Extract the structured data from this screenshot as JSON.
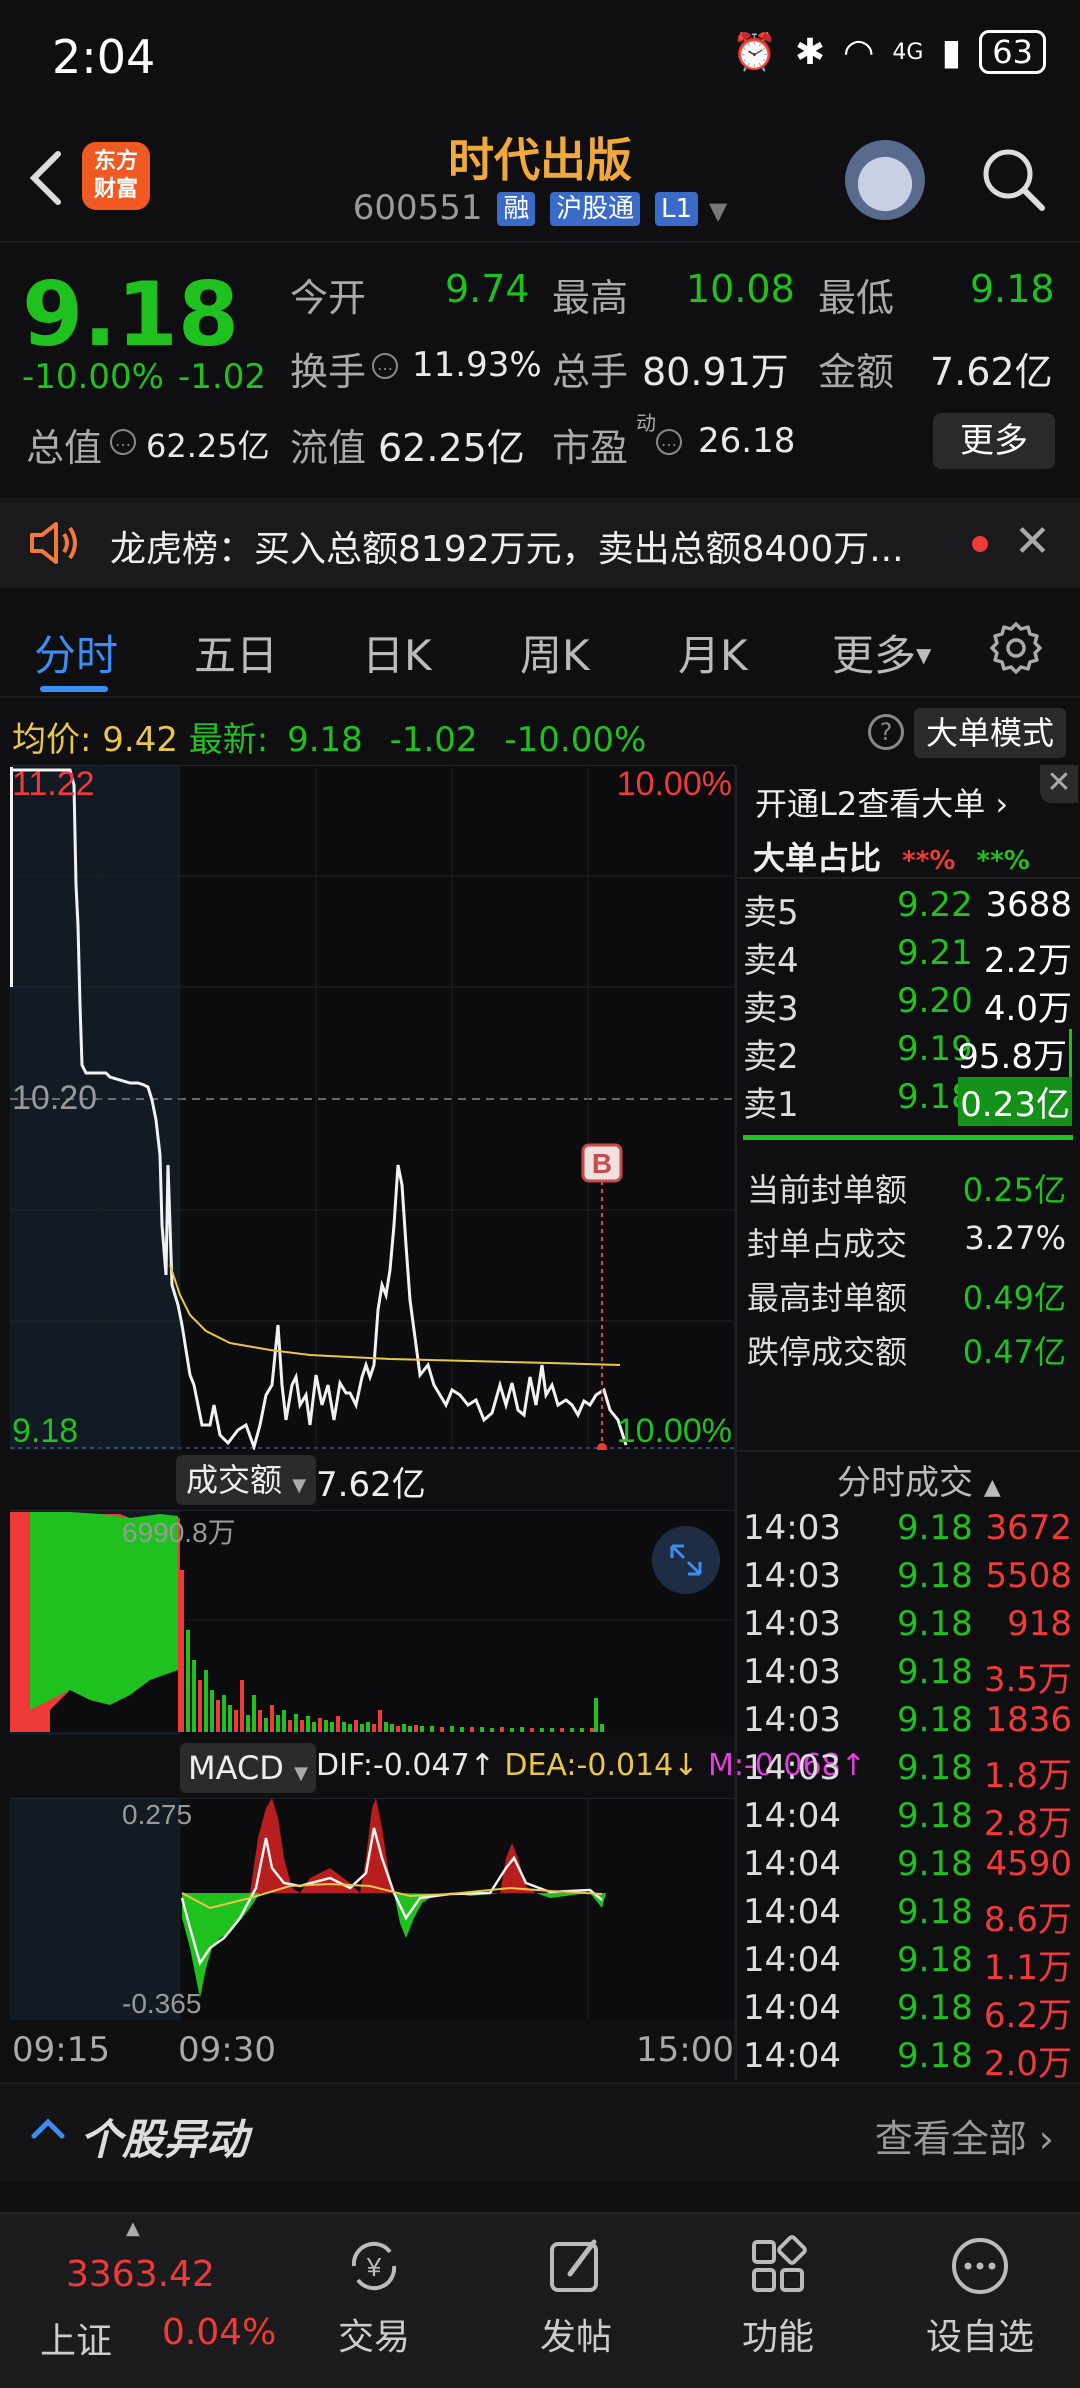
{
  "status_bar": {
    "time": "2:04",
    "network": "4G",
    "battery": "63"
  },
  "header": {
    "logo_line1": "东方",
    "logo_line2": "财富",
    "stock_name": "时代出版",
    "stock_code": "600551",
    "tags": [
      "融",
      "沪股通",
      "L1"
    ]
  },
  "quote": {
    "last_price": "9.18",
    "pct_change": "-10.00%",
    "amt_change": "-1.02",
    "fields": [
      {
        "label": "今开",
        "value": "9.74",
        "color": "#1fc11f"
      },
      {
        "label": "最高",
        "value": "10.08",
        "color": "#1fc11f"
      },
      {
        "label": "最低",
        "value": "9.18",
        "color": "#1fc11f"
      },
      {
        "label": "换手",
        "value": "11.93%",
        "color": "#e8e8e8"
      },
      {
        "label": "总手",
        "value": "80.91万",
        "color": "#e8e8e8"
      },
      {
        "label": "金额",
        "value": "7.62亿",
        "color": "#e8e8e8"
      },
      {
        "label": "总值",
        "value": "62.25亿",
        "color": "#e8e8e8"
      },
      {
        "label": "流值",
        "value": "62.25亿",
        "color": "#e8e8e8"
      },
      {
        "label": "市盈",
        "value": "26.18",
        "color": "#e8e8e8"
      }
    ],
    "pe_superscript": "动",
    "more_label": "更多"
  },
  "notice": {
    "text": "龙虎榜：买入总额8192万元，卖出总额8400万..."
  },
  "tabs": [
    "分时",
    "五日",
    "日K",
    "周K",
    "月K",
    "更多"
  ],
  "info_bar": {
    "avg_label": "均价:",
    "avg_value": "9.42",
    "latest_label": "最新:",
    "latest_value": "9.18",
    "latest_change": "-1.02",
    "latest_pct": "-10.00%",
    "help": "?",
    "mode_button": "大单模式"
  },
  "price_chart": {
    "y_top": "11.22",
    "y_mid": "10.20",
    "y_bottom": "9.18",
    "pct_top": "10.00%",
    "pct_bottom": "10.00%",
    "marker": "B"
  },
  "volume_panel": {
    "selector": "成交额",
    "total": "7.62亿",
    "max_label": "6990.8万"
  },
  "macd_panel": {
    "selector": "MACD",
    "dif": "DIF:-0.047↑",
    "dea": "DEA:-0.014↓",
    "m": "M:-0.068↑",
    "top_label": "0.275",
    "bottom_label": "-0.365"
  },
  "time_axis": [
    "09:15",
    "09:30",
    "15:00"
  ],
  "order_book": {
    "l2_link": "开通L2查看大单",
    "big_ratio_label": "大单占比",
    "big_ratio_red": "**%",
    "big_ratio_green": "**%",
    "asks": [
      {
        "label": "卖5",
        "price": "9.22",
        "vol": "3688"
      },
      {
        "label": "卖4",
        "price": "9.21",
        "vol": "2.2万"
      },
      {
        "label": "卖3",
        "price": "9.20",
        "vol": "4.0万"
      },
      {
        "label": "卖2",
        "price": "9.19",
        "vol": "95.8万"
      },
      {
        "label": "卖1",
        "price": "9.18",
        "vol": "0.23亿"
      }
    ],
    "stats": [
      {
        "label": "当前封单额",
        "value": "0.25亿",
        "color": "#1fc11f"
      },
      {
        "label": "封单占成交",
        "value": "3.27%",
        "color": "#e8e8e8"
      },
      {
        "label": "最高封单额",
        "value": "0.49亿",
        "color": "#1fc11f"
      },
      {
        "label": "跌停成交额",
        "value": "0.47亿",
        "color": "#1fc11f"
      }
    ]
  },
  "ticks": {
    "title": "分时成交",
    "rows": [
      {
        "time": "14:03",
        "price": "9.18",
        "vol": "3672"
      },
      {
        "time": "14:03",
        "price": "9.18",
        "vol": "5508"
      },
      {
        "time": "14:03",
        "price": "9.18",
        "vol": "918"
      },
      {
        "time": "14:03",
        "price": "9.18",
        "vol": "3.5万"
      },
      {
        "time": "14:03",
        "price": "9.18",
        "vol": "1836"
      },
      {
        "time": "14:03",
        "price": "9.18",
        "vol": "1.8万"
      },
      {
        "time": "14:04",
        "price": "9.18",
        "vol": "2.8万"
      },
      {
        "time": "14:04",
        "price": "9.18",
        "vol": "4590"
      },
      {
        "time": "14:04",
        "price": "9.18",
        "vol": "8.6万"
      },
      {
        "time": "14:04",
        "price": "9.18",
        "vol": "1.1万"
      },
      {
        "time": "14:04",
        "price": "9.18",
        "vol": "6.2万"
      },
      {
        "time": "14:04",
        "price": "9.18",
        "vol": "2.0万"
      }
    ]
  },
  "anomaly": {
    "title": "个股异动",
    "see_all": "查看全部"
  },
  "bottom_nav": {
    "index_value": "3363.42",
    "index_name": "上证",
    "index_pct": "0.04%",
    "items": [
      "交易",
      "发帖",
      "功能",
      "设自选"
    ]
  },
  "colors": {
    "up": "#f03a3a",
    "down": "#1fc11f",
    "accent": "#3a8ff0",
    "title": "#f2a93b"
  }
}
